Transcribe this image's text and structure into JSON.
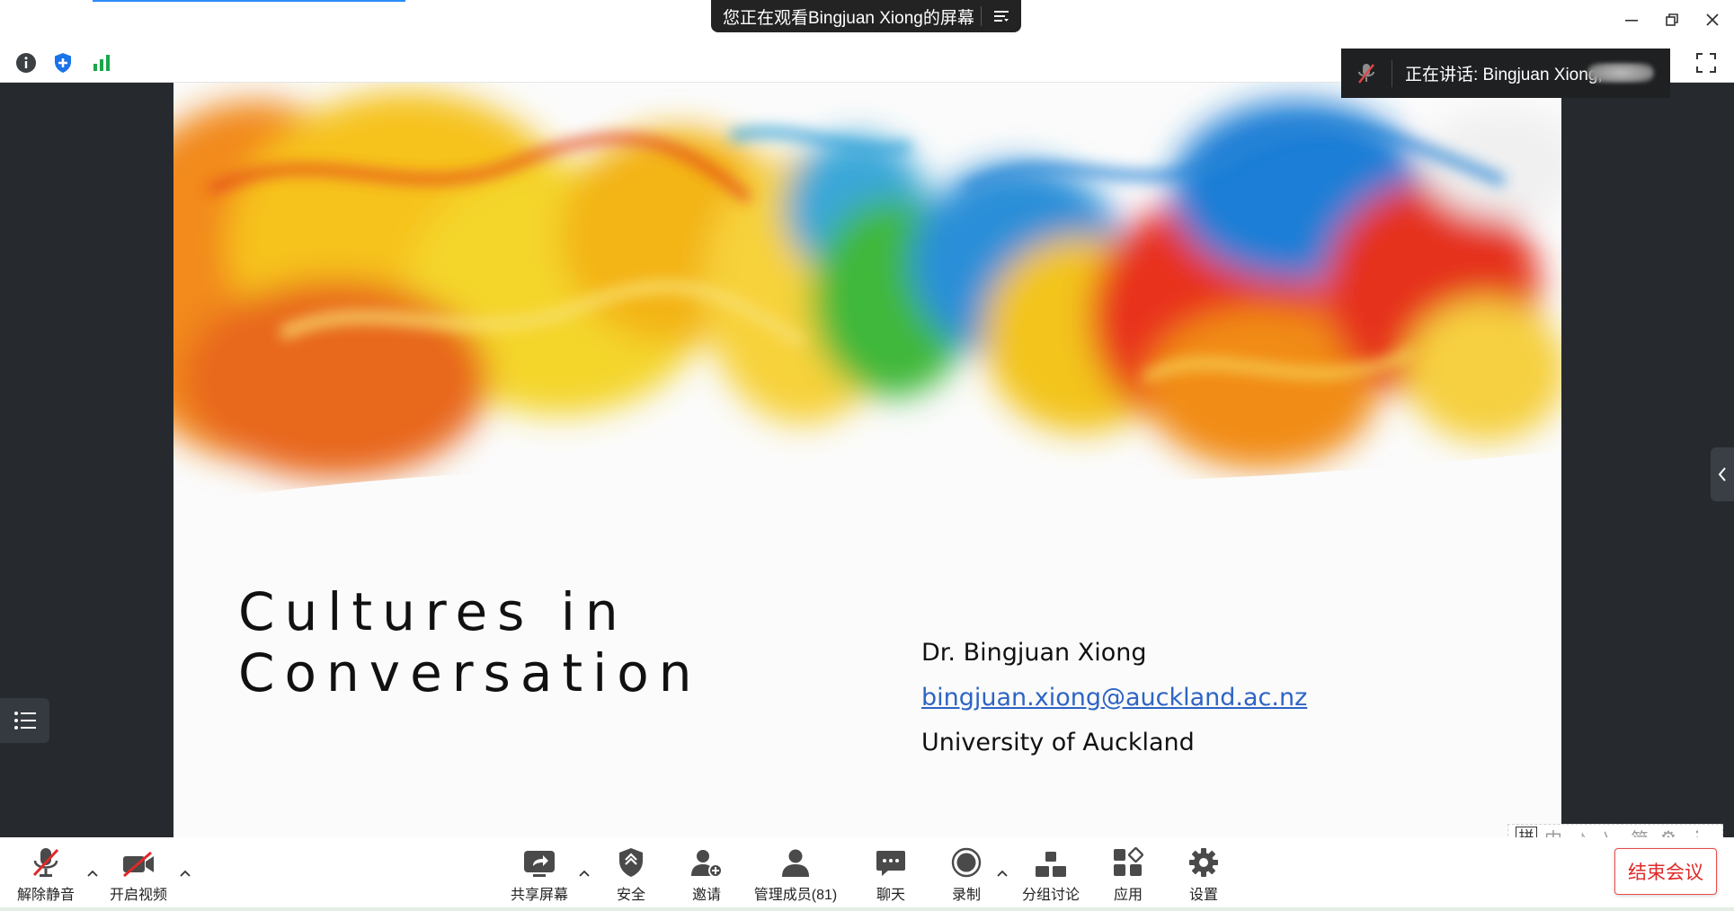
{
  "titlebar": {
    "share_banner": "您正在观看Bingjuan Xiong的屏幕",
    "menu_icon": "menu-icon",
    "minimize_icon": "minimize-icon",
    "restore_icon": "restore-icon",
    "close_icon": "close-icon"
  },
  "statusrow": {
    "info_icon": "info-icon",
    "security_icon": "shield-icon",
    "signal_icon": "signal-bars-icon",
    "fullscreen_icon": "fullscreen-icon"
  },
  "speaking": {
    "label": "正在讲话: Bingjuan Xiong;",
    "mic_icon": "microphone-muted-icon"
  },
  "slide": {
    "title_line1": "Cultures in",
    "title_line2": "Conversation",
    "author": "Dr. Bingjuan Xiong",
    "email": "bingjuan.xiong@auckland.ac.nz",
    "affiliation": "University of Auckland"
  },
  "ime": {
    "items": [
      "拼",
      "中",
      "♪",
      "乀",
      "简",
      "⚙",
      "⋮"
    ]
  },
  "toolbar": {
    "unmute": "解除静音",
    "start_video": "开启视频",
    "share_screen": "共享屏幕",
    "security": "安全",
    "invite": "邀请",
    "participants": "管理成员(81)",
    "chat": "聊天",
    "record": "录制",
    "breakout": "分组讨论",
    "apps": "应用",
    "settings": "设置",
    "end_meeting": "结束会议"
  },
  "colors": {
    "accent": "#2d8cff",
    "stage": "#262a2f",
    "end_red": "#e02828",
    "link_blue": "#2e64c4"
  }
}
